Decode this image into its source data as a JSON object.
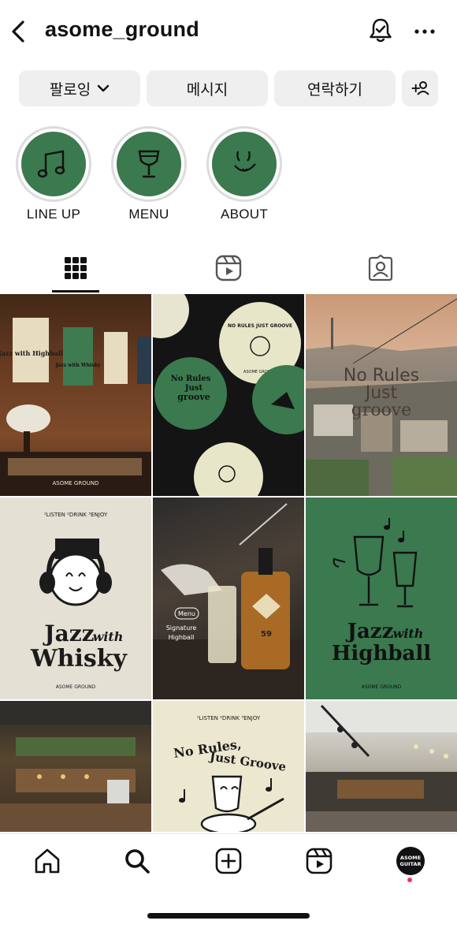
{
  "header": {
    "username": "asome_ground",
    "icons": [
      "back-chevron-icon",
      "bell-check-icon",
      "more-dots-icon"
    ]
  },
  "actions": {
    "follow_label": "팔로잉",
    "message_label": "메시지",
    "contact_label": "연락하기",
    "add_person_label": "+"
  },
  "highlights": [
    {
      "label": "LINE UP",
      "icon": "music-note-icon"
    },
    {
      "label": "MENU",
      "icon": "wine-glass-icon"
    },
    {
      "label": "ABOUT",
      "icon": "face-doodle-icon"
    }
  ],
  "tabs": [
    "grid-icon",
    "reels-icon",
    "tagged-icon"
  ],
  "colors": {
    "accent_green": "#3a7a4e",
    "button_bg": "#efefef",
    "notification_dot": "#ff2e55"
  },
  "posts": {
    "p1": {
      "caption": "ASOME GROUND",
      "poster_a": "Jazz with Highball",
      "poster_b": "Jazz with Whisky"
    },
    "p2": {
      "line1": "No Rules",
      "line2": "Just",
      "line3": "groove",
      "badge": "NO RULES JUST GROOVE",
      "brand": "ASOME GROUND"
    },
    "p3": {
      "line1": "No Rules",
      "line2": "Just",
      "line3": "groove"
    },
    "p4": {
      "top": "¹LISTEN  ²DRINK  ³ENJOY",
      "line1": "Jazz",
      "with": "with",
      "line2": "Whisky",
      "brand": "ASOME GROUND"
    },
    "p5": {
      "tag": "Menu",
      "line1": "Signature",
      "line2": "Highball",
      "label": "59"
    },
    "p6": {
      "line1": "Jazz",
      "with": "with",
      "line2": "Highball",
      "brand": "ASOME GROUND"
    },
    "p8": {
      "top": "¹LISTEN  ²DRINK  ³ENJOY",
      "line1": "No Rules,",
      "line2": "Just Groove"
    }
  },
  "profile_avatar": {
    "line1": "ASOME",
    "line2": "GUITAR"
  }
}
